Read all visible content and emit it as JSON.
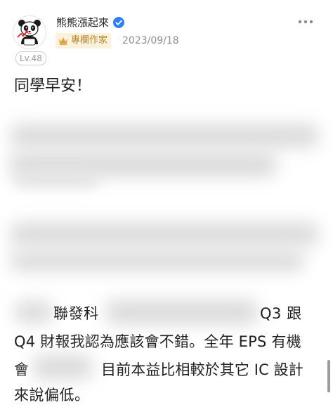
{
  "author": {
    "name": "熊熊漲起來",
    "badge_label": "專欄作家",
    "level": "Lv.48",
    "date": "2023/09/18"
  },
  "post": {
    "greeting": "同學早安！",
    "line1_fragment_a": "聯發科",
    "line1_fragment_b": "Q3 跟",
    "line2": "Q4 財報我認為應該會不錯。全年 EPS 有機",
    "line3_prefix": "會",
    "line3_suffix": "目前本益比相較於其它 IC 設計",
    "line4": "來說偏低。"
  },
  "icons": {
    "verified": "verified-check-icon",
    "crown": "crown-icon",
    "more": "more-options-icon",
    "avatar": "panda-avatar"
  },
  "colors": {
    "verified": "#2f7ff5",
    "badge_bg": "#fbf2dd",
    "badge_text": "#b5832a",
    "muted": "#8e8e8e"
  }
}
